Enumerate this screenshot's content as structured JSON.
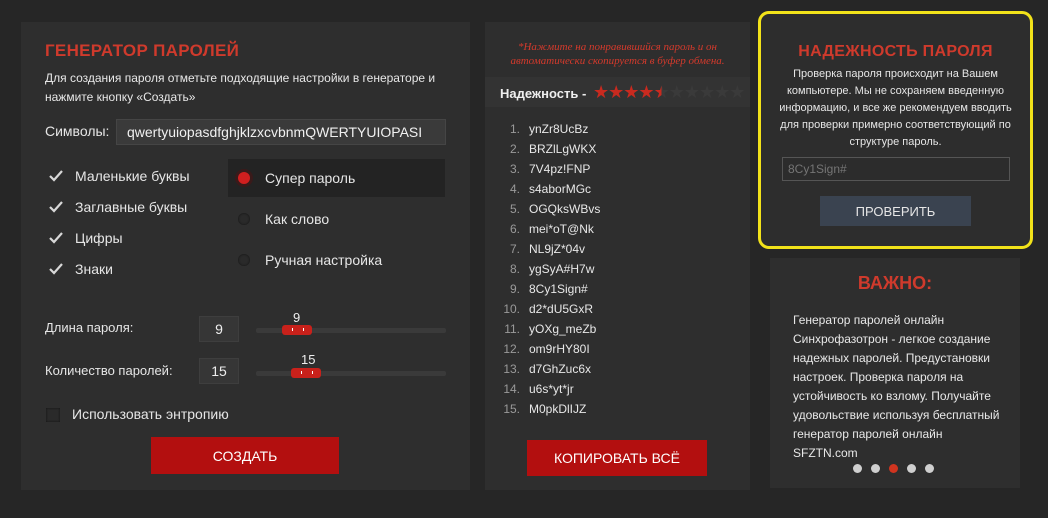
{
  "generator": {
    "title": "ГЕНЕРАТОР ПАРОЛЕЙ",
    "description": "Для создания пароля отметьте подходящие настройки в генераторе и нажмите кнопку «Создать»",
    "symbols_label": "Символы:",
    "symbols_value": "qwertyuiopasdfghjklzxcvbnmQWERTYUIOPASI",
    "checkboxes": [
      {
        "label": "Маленькие буквы",
        "checked": true
      },
      {
        "label": "Заглавные буквы",
        "checked": true
      },
      {
        "label": "Цифры",
        "checked": true
      },
      {
        "label": "Знаки",
        "checked": true
      }
    ],
    "modes": [
      {
        "label": "Супер пароль",
        "selected": true
      },
      {
        "label": "Как слово",
        "selected": false
      },
      {
        "label": "Ручная настройка",
        "selected": false
      }
    ],
    "length_label": "Длина пароля:",
    "length_value": "9",
    "length_slider_value": "9",
    "count_label": "Количество паролей:",
    "count_value": "15",
    "count_slider_value": "15",
    "entropy_label": "Использовать энтропию",
    "entropy_checked": false,
    "create_button": "СОЗДАТЬ"
  },
  "list": {
    "note": "*Нажмите на понравившийся пароль и он автоматически скопируется в буфер обмена.",
    "strength_label": "Надежность -",
    "strength_rating": 4.5,
    "strength_max": 10,
    "passwords": [
      {
        "num": "1.",
        "pw": "ynZr8UcBz"
      },
      {
        "num": "2.",
        "pw": "BRZlLgWKX"
      },
      {
        "num": "3.",
        "pw": "7V4pz!FNP"
      },
      {
        "num": "4.",
        "pw": "s4aborMGc"
      },
      {
        "num": "5.",
        "pw": "OGQksWBvs"
      },
      {
        "num": "6.",
        "pw": "mei*oT@Nk"
      },
      {
        "num": "7.",
        "pw": "NL9jZ*04v"
      },
      {
        "num": "8.",
        "pw": "ygSyA#H7w"
      },
      {
        "num": "9.",
        "pw": "8Cy1Sign#"
      },
      {
        "num": "10.",
        "pw": "d2*dU5GxR"
      },
      {
        "num": "11.",
        "pw": "yOXg_meZb"
      },
      {
        "num": "12.",
        "pw": "om9rHY80I"
      },
      {
        "num": "13.",
        "pw": "d7GhZuc6x"
      },
      {
        "num": "14.",
        "pw": "u6s*yt*jr"
      },
      {
        "num": "15.",
        "pw": "M0pkDlIJZ"
      }
    ],
    "copy_button": "КОПИРОВАТЬ ВСЁ"
  },
  "check": {
    "title": "НАДЕЖНОСТЬ ПАРОЛЯ",
    "description": "Проверка пароля происходит на Вашем компьютере. Мы не сохраняем введенную информацию, и все же рекомендуем вводить для проверки примерно соответствующий по структуре пароль.",
    "input_placeholder": "8Cy1Sign#",
    "button": "ПРОВЕРИТЬ"
  },
  "important": {
    "title": "ВАЖНО:",
    "text": "Генератор паролей онлайн Синхрофазотрон - легкое создание надежных паролей. Предустановки настроек. Проверка пароля на устойчивость ко взлому. Получайте удовольствие используя бесплатный генератор паролей онлайн SFZTN.com",
    "dots_count": 5,
    "active_dot": 3
  },
  "colors": {
    "accent_red": "#cf3a2c",
    "button_red": "#b30f0f",
    "highlight_yellow": "#f2e21a",
    "background": "#262626"
  }
}
